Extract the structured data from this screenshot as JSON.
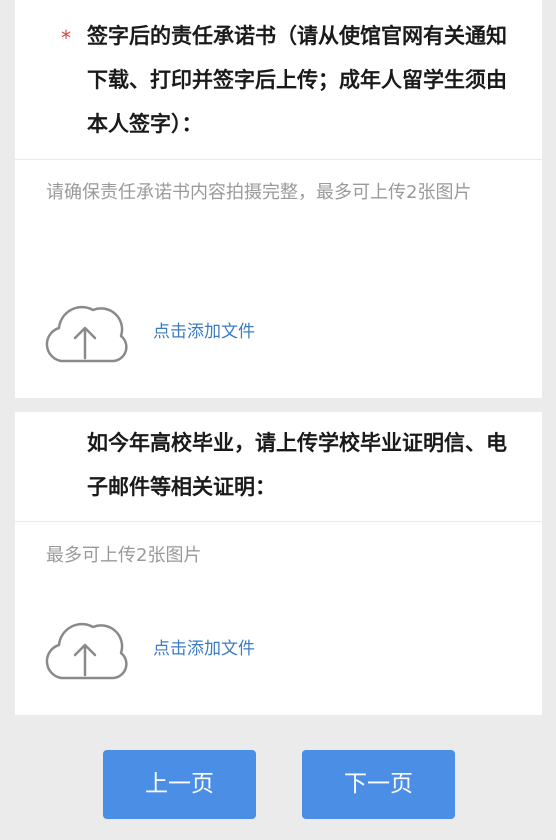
{
  "card1": {
    "required_mark": "*",
    "question": "签字后的责任承诺书（请从使馆官网有关通知下载、打印并签字后上传；成年人留学生须由本人签字）：",
    "hint": "请确保责任承诺书内容拍摄完整，最多可上传2张图片",
    "upload_label": "点击添加文件"
  },
  "card2": {
    "question": "如今年高校毕业，请上传学校毕业证明信、电子邮件等相关证明：",
    "hint": "最多可上传2张图片",
    "upload_label": "点击添加文件"
  },
  "navigation": {
    "prev_label": "上一页",
    "next_label": "下一页"
  },
  "colors": {
    "page_background": "#ebebeb",
    "card_background": "#ffffff",
    "required_mark": "#d8463a",
    "link": "#3b7cc4",
    "button": "#4a8ee6",
    "hint_text": "#9a9a9a",
    "icon_stroke": "#8a8a8a"
  },
  "icons": {
    "upload": "cloud-upload-icon"
  }
}
